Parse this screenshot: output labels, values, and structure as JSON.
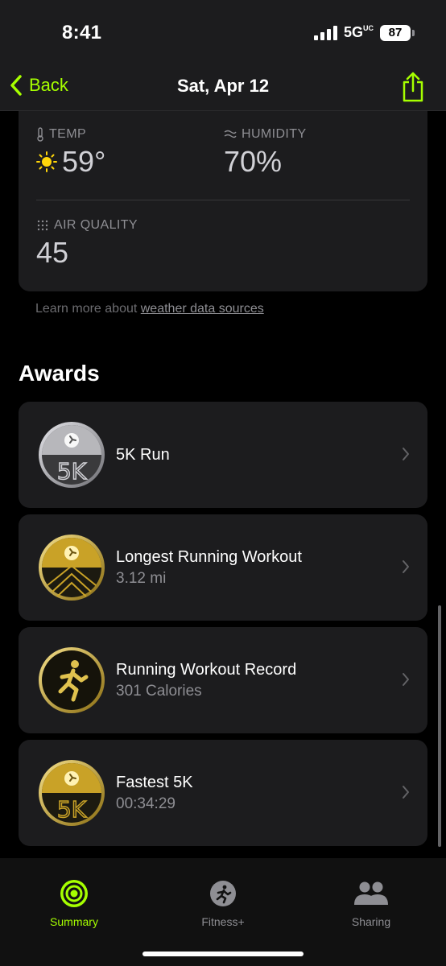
{
  "status": {
    "time": "8:41",
    "network": "5G",
    "network_sup": "UC",
    "battery": "87"
  },
  "nav": {
    "back_label": "Back",
    "title": "Sat, Apr 12"
  },
  "weather": {
    "temp_label": "TEMP",
    "temp_value": "59°",
    "humidity_label": "HUMIDITY",
    "humidity_value": "70%",
    "air_label": "AIR QUALITY",
    "air_value": "45",
    "note_prefix": "Learn more about ",
    "note_link": "weather data sources"
  },
  "awards": {
    "title": "Awards",
    "items": [
      {
        "title": "5K Run",
        "subtitle": "",
        "medal": "silver-5k-medal"
      },
      {
        "title": "Longest Running Workout",
        "subtitle": "3.12 mi",
        "medal": "gold-longest-medal"
      },
      {
        "title": "Running Workout Record",
        "subtitle": "301 Calories",
        "medal": "gold-record-medal"
      },
      {
        "title": "Fastest 5K",
        "subtitle": "00:34:29",
        "medal": "gold-5k-medal"
      }
    ]
  },
  "tabs": [
    {
      "label": "Summary",
      "icon": "activity-rings-icon",
      "active": true
    },
    {
      "label": "Fitness+",
      "icon": "runner-icon",
      "active": false
    },
    {
      "label": "Sharing",
      "icon": "people-icon",
      "active": false
    }
  ],
  "colors": {
    "accent": "#a6ff00",
    "card": "#1c1c1e",
    "gold": "#c9a227",
    "silver": "#b7b7bb"
  }
}
